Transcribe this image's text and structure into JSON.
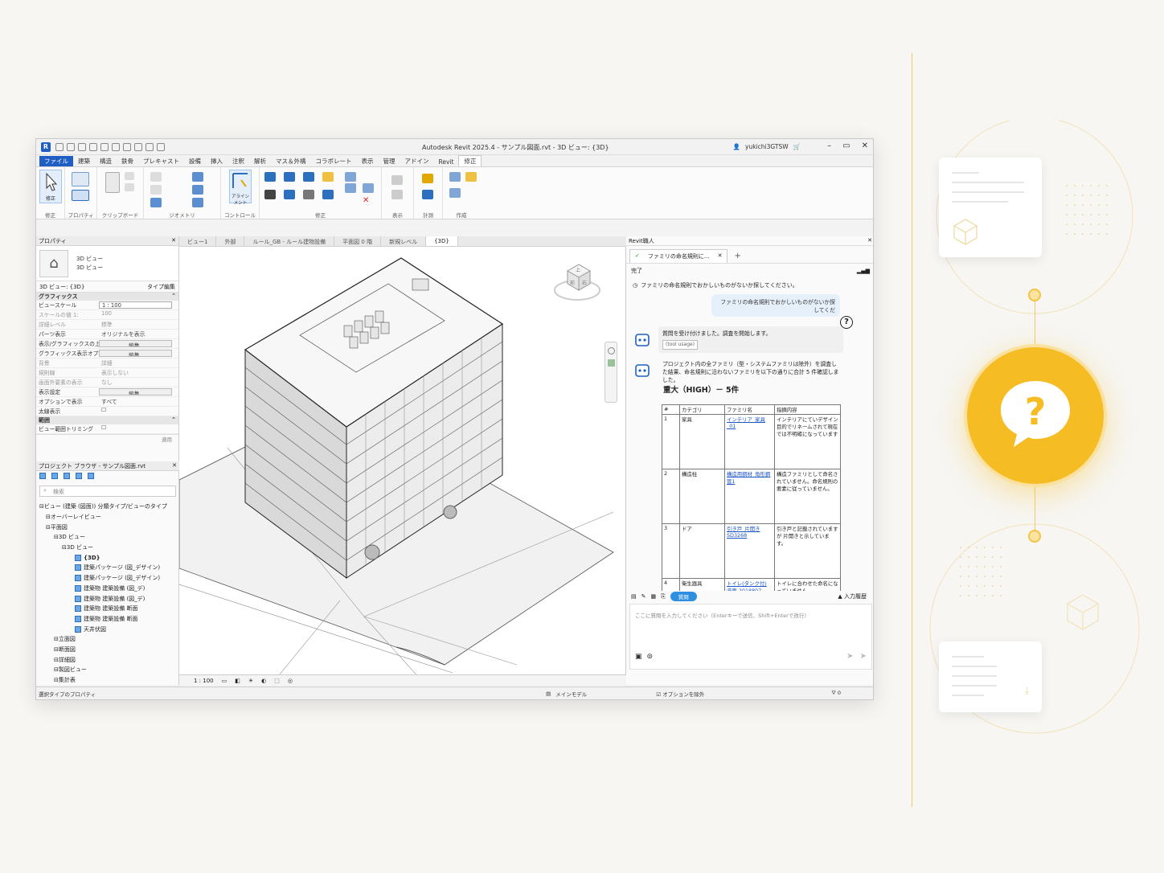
{
  "window": {
    "title": "Autodesk Revit 2025.4 - サンプル図面.rvt - 3D ビュー: {3D}",
    "user": "yukichi3GTSW",
    "app_letter": "R"
  },
  "ribbon_tabs": [
    "ファイル",
    "建築",
    "構造",
    "鉄骨",
    "プレキャスト",
    "設備",
    "挿入",
    "注釈",
    "解析",
    "マス＆外構",
    "コラボレート",
    "表示",
    "管理",
    "アドイン",
    "Revit",
    "修正"
  ],
  "ribbon_groups": [
    "修正",
    "プロパティ",
    "クリップボード",
    "ジオメトリ",
    "コントロール",
    "修正",
    "表示",
    "計測",
    "作成"
  ],
  "ribbon_buttons": {
    "select": "修正",
    "properties": "プロパティ",
    "paste": "貼り付け",
    "align": "アラインメント"
  },
  "properties": {
    "header": "プロパティ",
    "type_line1": "3D ビュー",
    "type_line2": "3D ビュー",
    "view_selector": "3D ビュー: {3D}",
    "edit_type": "タイプ編集",
    "section_graphics": "グラフィックス",
    "section_extents": "範囲",
    "rows": [
      {
        "k": "ビュースケール",
        "v": "1 : 100",
        "style": "box"
      },
      {
        "k": "スケールの値    1:",
        "v": "100",
        "style": "grey"
      },
      {
        "k": "詳細レベル",
        "v": "標準",
        "style": "grey"
      },
      {
        "k": "パーツ表示",
        "v": "オリジナルを表示",
        "style": ""
      },
      {
        "k": "表示/グラフィックスの上書き",
        "v": "編集...",
        "style": "btn"
      },
      {
        "k": "グラフィックス表示オプション",
        "v": "編集...",
        "style": "btn"
      },
      {
        "k": "背景",
        "v": "詳細",
        "style": "grey"
      },
      {
        "k": "規則線",
        "v": "表示しない",
        "style": "grey"
      },
      {
        "k": "画面外要素の表示",
        "v": "なし",
        "style": "grey"
      },
      {
        "k": "表示設定",
        "v": "編集...",
        "style": "btn"
      },
      {
        "k": "オプションで表示",
        "v": "すべて",
        "style": ""
      },
      {
        "k": "太線表示",
        "v": "☐",
        "style": ""
      }
    ],
    "extent_rows": [
      {
        "k": "ビュー範囲トリミング",
        "v": "☐",
        "style": ""
      }
    ],
    "apply": "適用"
  },
  "browser": {
    "header": "プロジェクト ブラウザ - サンプル図面.rvt",
    "search_placeholder": "検索",
    "tree": [
      {
        "text": "ビュー (建築 (図面)) 分類タイプ/ビューのタイプ",
        "indent": 4
      },
      {
        "text": "オーバーレイビュー",
        "indent": 12
      },
      {
        "text": "平面図",
        "indent": 12
      },
      {
        "text": "3D ビュー",
        "indent": 22
      },
      {
        "text": "3D ビュー",
        "indent": 32
      },
      {
        "text": "{3D}",
        "indent": 48,
        "icon": true,
        "selected": true
      },
      {
        "text": "建築パッケージ (図_デザイン)",
        "indent": 48,
        "icon": true
      },
      {
        "text": "建築パッケージ (図_デザイン)",
        "indent": 48,
        "icon": true
      },
      {
        "text": "建築物 建築設備 (図_デ)",
        "indent": 48,
        "icon": true
      },
      {
        "text": "建築物 建築設備 (図_デ)",
        "indent": 48,
        "icon": true
      },
      {
        "text": "建築物 建築設備 断面",
        "indent": 48,
        "icon": true
      },
      {
        "text": "建築物 建築設備 断面",
        "indent": 48,
        "icon": true
      },
      {
        "text": "天井伏図",
        "indent": 48,
        "icon": true
      },
      {
        "text": "立面図",
        "indent": 22
      },
      {
        "text": "断面図",
        "indent": 22
      },
      {
        "text": "詳細図",
        "indent": 22
      },
      {
        "text": "製図ビュー",
        "indent": 22
      },
      {
        "text": "集計表",
        "indent": 22
      }
    ]
  },
  "view_tabs": [
    {
      "label": "ビュー1",
      "active": false
    },
    {
      "label": "外部",
      "active": false
    },
    {
      "label": "ルール_GB - ルール建物設備",
      "active": false
    },
    {
      "label": "平面図 0 階",
      "active": false
    },
    {
      "label": "新規レベル",
      "active": false
    },
    {
      "label": "{3D}",
      "active": true
    }
  ],
  "viewcube": {
    "top": "上",
    "front": "前",
    "right": "右"
  },
  "view_scale": "1 : 100",
  "chat": {
    "panel_title": "Revit職人",
    "tab_title": "ファミリの命名規則に...",
    "status": "完了",
    "system_msg": "ファミリの命名規則でおかしいものがないか探してください。",
    "user_msg": "ファミリの命名規則でおかしいものがないか探してくだ",
    "bot_msg1": "質問を受け付けました。調査を開始します。",
    "bot_chip": "(tool usage)",
    "bot_msg2": "プロジェクト内の全ファミリ（型・システムファミリは除外）を調査した結果、命名規則に沿わないファミリを以下の通りに合計 5 件確認しました。",
    "severity_heading": "重大（HIGH）－ 5件",
    "table_headers": [
      "#",
      "カテゴリ",
      "ファミリ名",
      "指摘内容"
    ],
    "table_rows": [
      {
        "n": "1",
        "cat": "家具",
        "fam": "インテリア_家具_01",
        "issue": "インテリアにていデザイン目的でリネームされて現在では不明確になっています"
      },
      {
        "n": "2",
        "cat": "構造柱",
        "fam": "構造用鋼材_角形鋼管1",
        "issue": "構造ファミリとして命名されていません。命名規則の要素に従っていません。"
      },
      {
        "n": "3",
        "cat": "ドア",
        "fam": "引き戸_片開き SD3268",
        "issue": "引き戸と記載されていますが 片開きと示しています。"
      },
      {
        "n": "4",
        "cat": "衛生器具",
        "fam": "トイレ(タンク付) 洗面 2018807",
        "issue": "トイレに合わせた命名になっていません。"
      }
    ],
    "mode_label": "質問",
    "history_label": "入力履歴",
    "input_placeholder": "ここに質問を入力してください（Enterキーで送信、Shift+Enterで改行）"
  },
  "statusbar": {
    "left": "選択タイプのプロパティ",
    "model": "メインモデル",
    "exclude": "オプションを除外",
    "count": "0"
  },
  "colors": {
    "accent": "#1f5fc4",
    "help_yellow": "#f6bc24",
    "line": "#f0c96b"
  }
}
